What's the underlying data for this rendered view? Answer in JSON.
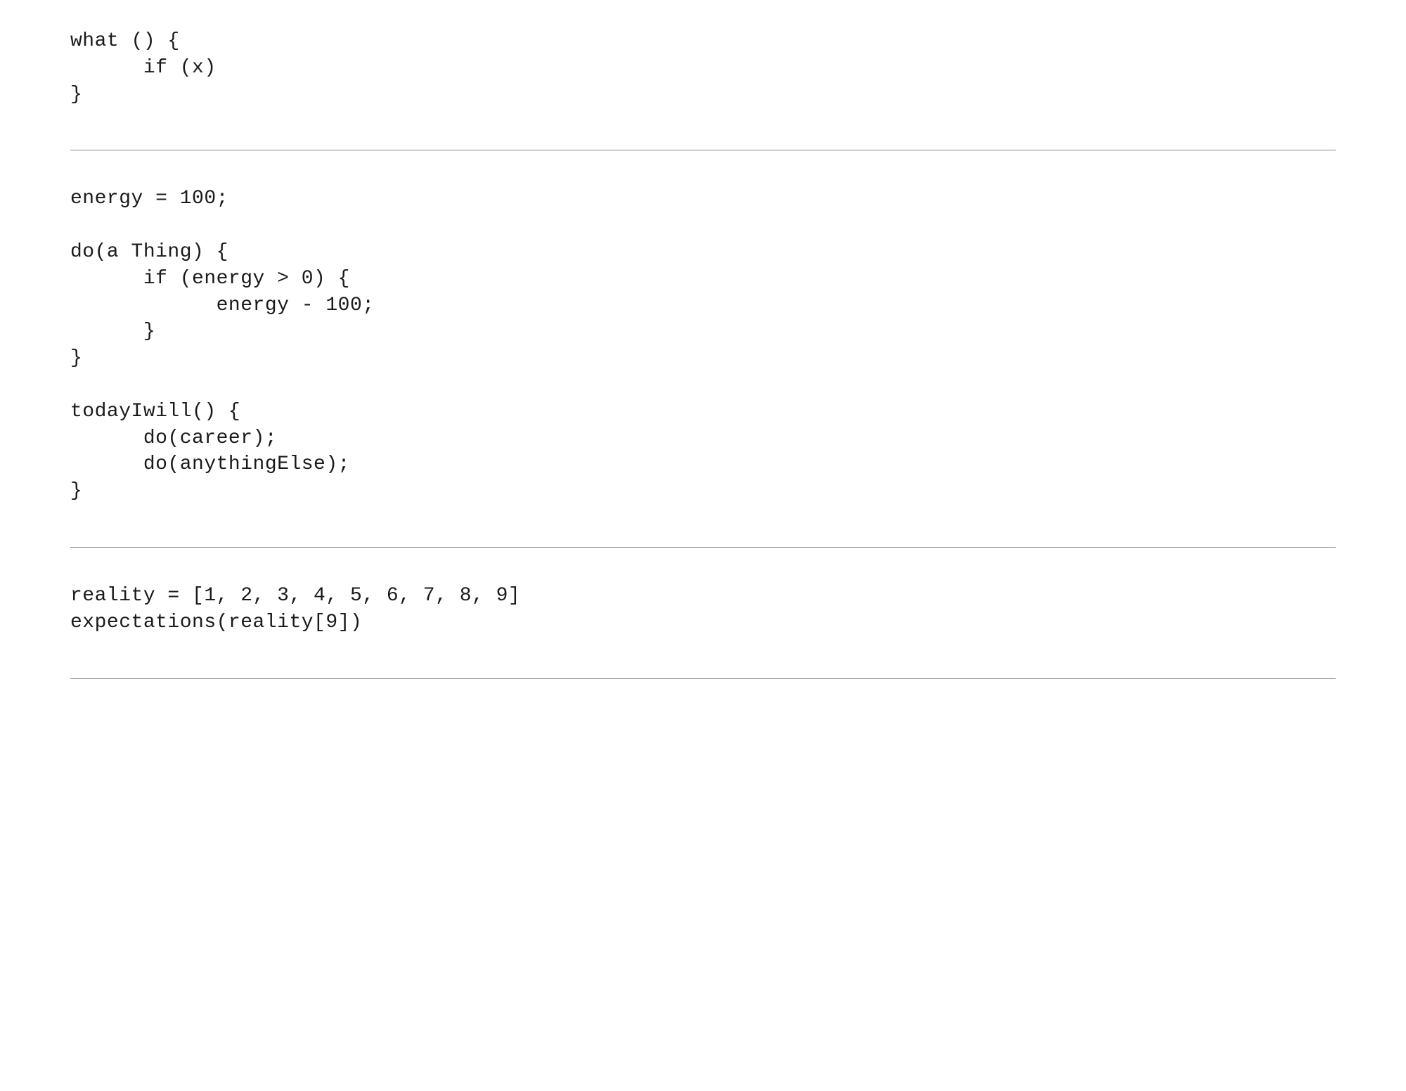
{
  "blocks": [
    {
      "lines": [
        "what () {",
        "      if (x)",
        "}"
      ]
    },
    {
      "lines": [
        "energy = 100;",
        "",
        "do(a Thing) {",
        "      if (energy > 0) {",
        "            energy - 100;",
        "      }",
        "}",
        "",
        "todayIwill() {",
        "      do(career);",
        "      do(anythingElse);",
        "}"
      ]
    },
    {
      "lines": [
        "reality = [1, 2, 3, 4, 5, 6, 7, 8, 9]",
        "expectations(reality[9])"
      ]
    }
  ]
}
